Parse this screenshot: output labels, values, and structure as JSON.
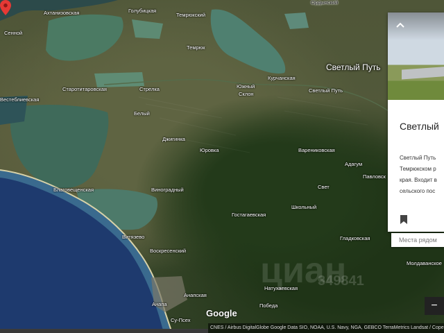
{
  "map": {
    "pin_label": "Светлый Путь",
    "labels": [
      {
        "text": "Ордынский",
        "pos": "p1"
      },
      {
        "text": "Ахтанизовская",
        "pos": "p2"
      },
      {
        "text": "Голубицкая",
        "pos": "p3"
      },
      {
        "text": "Темрюкский",
        "pos": "p4"
      },
      {
        "text": "Сенной",
        "pos": "p5"
      },
      {
        "text": "Темрюк",
        "pos": "p6"
      },
      {
        "text": "Курчанская",
        "pos": "p7"
      },
      {
        "text": "Старотитаровская",
        "pos": "p8"
      },
      {
        "text": "Стрелка",
        "pos": "p9"
      },
      {
        "text": "Южный",
        "pos": "p10"
      },
      {
        "text": "Склон",
        "pos": "p11"
      },
      {
        "text": "Светлый Путь",
        "pos": "p12"
      },
      {
        "text": "Вестеблиевская",
        "pos": "p13"
      },
      {
        "text": "Белый",
        "pos": "p14"
      },
      {
        "text": "Джигинка",
        "pos": "p15"
      },
      {
        "text": "Юровка",
        "pos": "p16"
      },
      {
        "text": "Варениковская",
        "pos": "p17"
      },
      {
        "text": "Адагум",
        "pos": "p18"
      },
      {
        "text": "Павловск",
        "pos": "p19"
      },
      {
        "text": "Благовещенская",
        "pos": "p20"
      },
      {
        "text": "Виноградный",
        "pos": "p21"
      },
      {
        "text": "Свет",
        "pos": "p22"
      },
      {
        "text": "Школьный",
        "pos": "p23"
      },
      {
        "text": "Гостагаевская",
        "pos": "p24"
      },
      {
        "text": "Витязево",
        "pos": "p25"
      },
      {
        "text": "Гладковская",
        "pos": "p26"
      },
      {
        "text": "Воскресенский",
        "pos": "p27"
      },
      {
        "text": "Молдаванское",
        "pos": "p28"
      },
      {
        "text": "Натухаевская",
        "pos": "p29"
      },
      {
        "text": "Анапа",
        "pos": "p30"
      },
      {
        "text": "Анапская",
        "pos": "p31"
      },
      {
        "text": "Победа",
        "pos": "p32"
      },
      {
        "text": "Су-Псех",
        "pos": "p33"
      }
    ]
  },
  "panel": {
    "collapse_icon": "chevron-up-icon",
    "title": "Светлый",
    "description_lines": [
      "Светлый Путь",
      "Темрюкском р",
      "края. Входит в",
      "сельского пос"
    ],
    "save_icon": "bookmark-icon"
  },
  "nearby_placeholder": "Места рядом",
  "zoom_out_label": "−",
  "watermark": {
    "brand": "циан",
    "number": "349841"
  },
  "google_logo": "Google",
  "attribution": "CNES / Airbus  DigitalGlobe  Google  Data SIO, NOAA, U.S. Navy, NGA, GEBCO  TerraMetrics  Landsat / Copernicus",
  "colors": {
    "sea": "#1e3a6e",
    "lagoon": "#3f6a5a",
    "pin": "#e53935"
  }
}
